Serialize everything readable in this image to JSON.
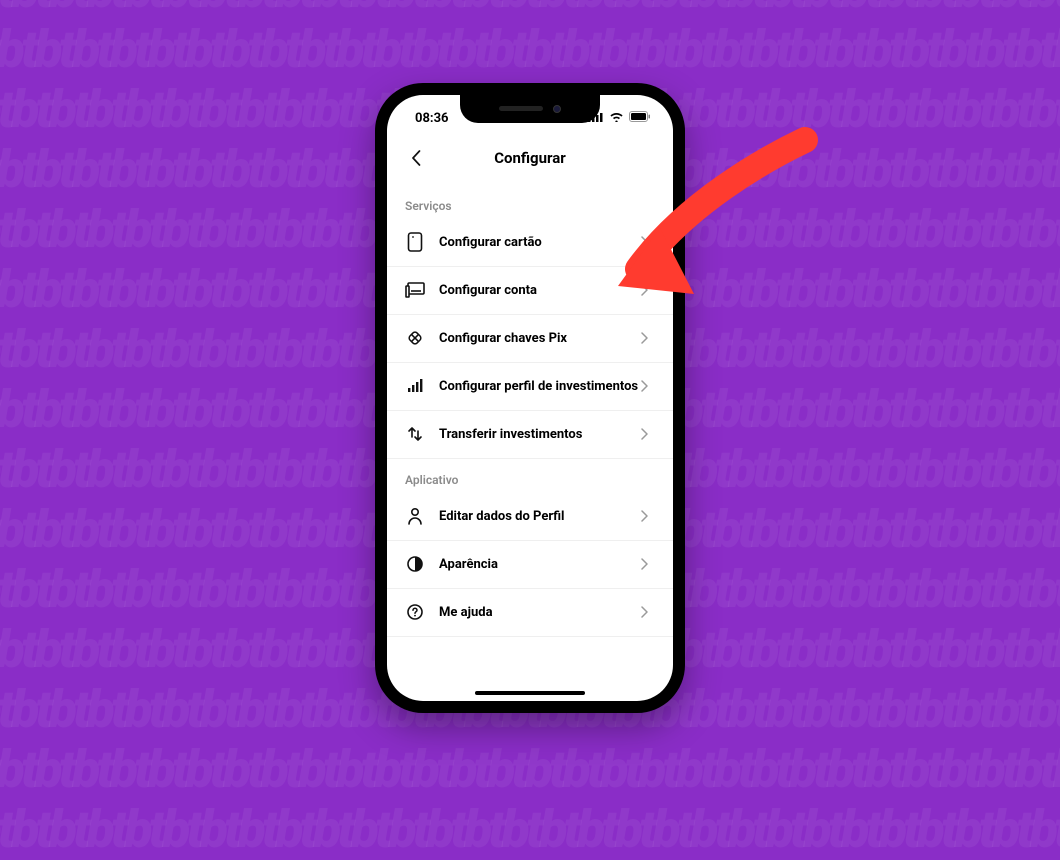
{
  "colors": {
    "background": "#8a2dc7",
    "accent_arrow": "#ff3b2f"
  },
  "status_bar": {
    "time": "08:36"
  },
  "nav": {
    "title": "Configurar"
  },
  "sections": {
    "servicos": {
      "header": "Serviços",
      "items": {
        "cartao": "Configurar cartão",
        "conta": "Configurar conta",
        "pix": "Configurar chaves Pix",
        "investimentos_perfil": "Configurar perfil de investimentos",
        "transferir_investimentos": "Transferir investimentos"
      }
    },
    "aplicativo": {
      "header": "Aplicativo",
      "items": {
        "perfil": "Editar dados do Perfil",
        "aparencia": "Aparência",
        "ajuda": "Me ajuda"
      }
    }
  },
  "annotation": {
    "target": "configurar-conta"
  }
}
